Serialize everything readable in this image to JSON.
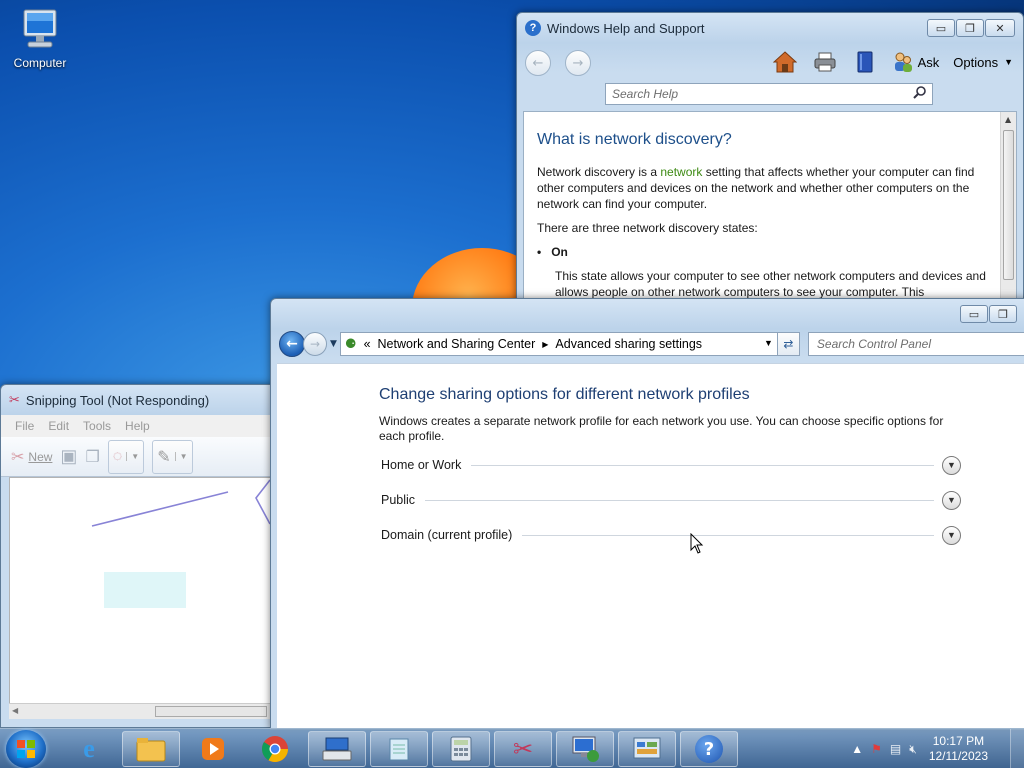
{
  "desktop": {
    "icons": [
      {
        "label": "Computer",
        "icon": "computer-icon"
      }
    ]
  },
  "help_window": {
    "title": "Windows Help and Support",
    "toolbar": {
      "ask_label": "Ask",
      "options_label": "Options"
    },
    "search_placeholder": "Search Help",
    "article": {
      "heading": "What is network discovery?",
      "p1_before": "Network discovery is a ",
      "p1_link": "network",
      "p1_after": " setting that affects whether your computer can find other computers and devices on the network and whether other computers on the network can find your computer.",
      "p2": "There are three network discovery states:",
      "bullet1": "On",
      "bullet1_desc": "This state allows your computer to see other network computers and devices and allows people on other network computers to see your computer. This"
    }
  },
  "snipping_tool": {
    "title": "Snipping Tool (Not Responding)",
    "menu": [
      "File",
      "Edit",
      "Tools",
      "Help"
    ],
    "new_label": "New"
  },
  "control_panel": {
    "breadcrumb": {
      "prefix": "«",
      "items": [
        "Network and Sharing Center",
        "Advanced sharing settings"
      ]
    },
    "search_placeholder": "Search Control Panel",
    "heading": "Change sharing options for different network profiles",
    "description": "Windows creates a separate network profile for each network you use. You can choose specific options for each profile.",
    "profiles": [
      "Home or Work",
      "Public",
      "Domain (current profile)"
    ]
  },
  "taskbar": {
    "items": [
      "internet-explorer-icon",
      "explorer-icon",
      "media-player-icon",
      "chrome-icon",
      "keyboard-icon",
      "notepad-icon",
      "calculator-icon",
      "snipping-tool-icon",
      "network-icon",
      "control-panel-icon",
      "help-icon"
    ],
    "clock": {
      "time": "10:17 PM",
      "date": "12/11/2023"
    }
  },
  "colors": {
    "link": "#3d8a13",
    "heading": "#1d4f8a"
  }
}
